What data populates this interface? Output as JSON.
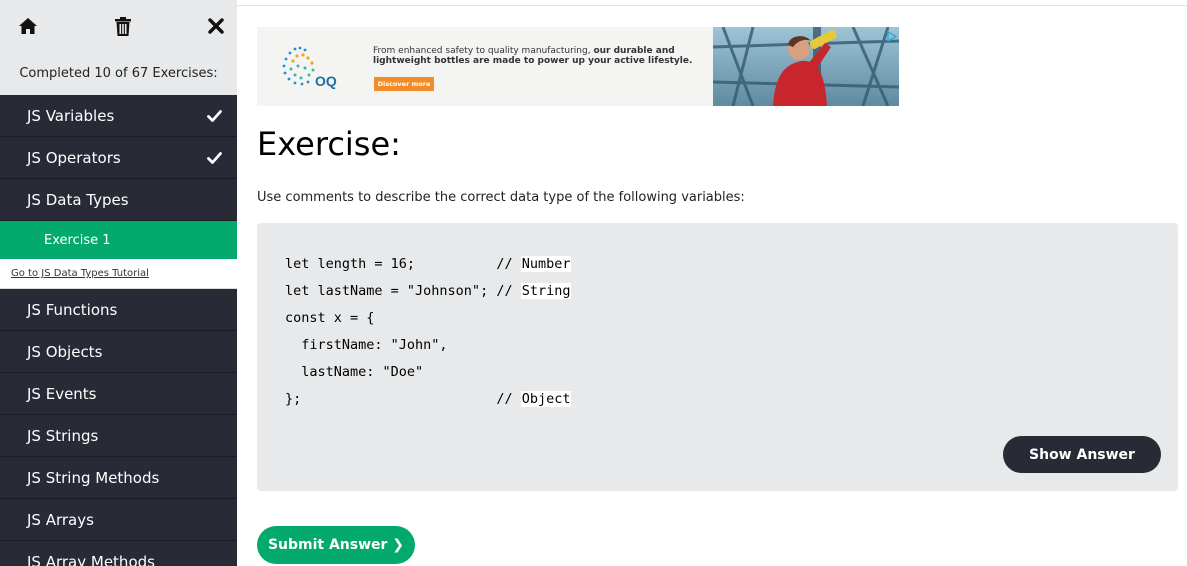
{
  "sidebar": {
    "icons": [
      "home-icon",
      "trash-icon",
      "close-icon"
    ],
    "progress_text": "Completed 10 of 67 Exercises:",
    "items": [
      {
        "label": "JS Variables",
        "checked": true
      },
      {
        "label": "JS Operators",
        "checked": true
      },
      {
        "label": "JS Data Types",
        "checked": false,
        "current": true
      },
      {
        "label": "JS Functions"
      },
      {
        "label": "JS Objects"
      },
      {
        "label": "JS Events"
      },
      {
        "label": "JS Strings"
      },
      {
        "label": "JS String Methods"
      },
      {
        "label": "JS Arrays"
      },
      {
        "label": "JS Array Methods"
      }
    ],
    "active_exercise": "Exercise 1",
    "tutorial_link": "Go to JS Data Types Tutorial"
  },
  "ad": {
    "text_plain": "From enhanced safety to quality manufacturing, ",
    "text_bold": "our durable and lightweight bottles are made to power up your active lifestyle.",
    "button": "Discover more",
    "logo_text": "OQ"
  },
  "exercise": {
    "title": "Exercise:",
    "instructions": "Use comments to describe the correct data type of the following variables:",
    "code": {
      "line1": "let length = 16;          // ",
      "ans1": "Number",
      "line2": "let lastName = \"Johnson\"; // ",
      "ans2": "String",
      "line3": "const x = {",
      "line4": "  firstName: \"John\",",
      "line5": "  lastName: \"Doe\"",
      "line6": "};                        // ",
      "ans3": "Object"
    },
    "show_answer": "Show Answer",
    "submit": "Submit Answer ❯"
  },
  "colors": {
    "sidebar_bg": "#282a35",
    "accent_green": "#04aa6d",
    "code_bg": "#e7e9eb",
    "ad_button": "#f08c2a"
  }
}
